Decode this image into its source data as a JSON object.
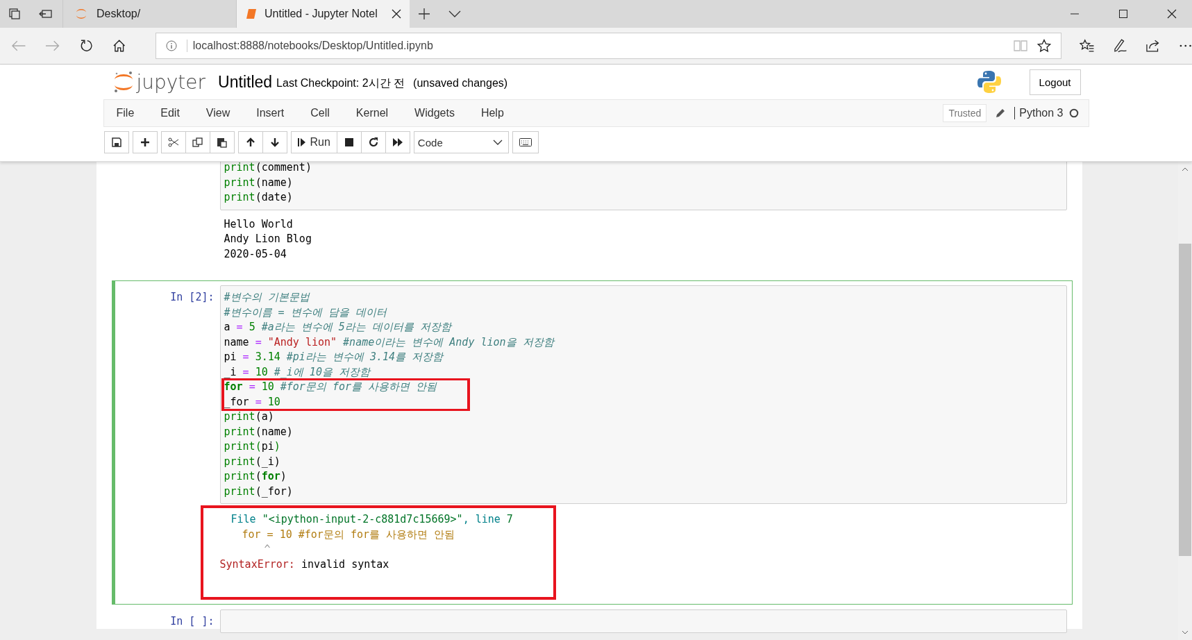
{
  "browser": {
    "tabs": [
      {
        "label": "Desktop/",
        "kind": "jupyter",
        "selected": false
      },
      {
        "label": "Untitled - Jupyter Notel",
        "kind": "notebook",
        "selected": true
      }
    ],
    "url": "localhost:8888/notebooks/Desktop/Untitled.ipynb"
  },
  "header": {
    "logo_text": "jupyter",
    "notebook_name": "Untitled",
    "checkpoint": "Last Checkpoint: 2시간 전",
    "status": "(unsaved changes)",
    "logout": "Logout"
  },
  "menu": [
    "File",
    "Edit",
    "View",
    "Insert",
    "Cell",
    "Kernel",
    "Widgets",
    "Help"
  ],
  "trusted": "Trusted",
  "kernel": "Python 3",
  "toolbar": {
    "run_label": "Run",
    "cell_type": "Code"
  },
  "cells": [
    {
      "selected": false,
      "input": [
        {
          "marked": false,
          "tokens": [
            {
              "kind": "builtin",
              "text": "print"
            },
            {
              "kind": "plain",
              "text": "(comment)"
            }
          ]
        },
        {
          "marked": false,
          "tokens": [
            {
              "kind": "builtin",
              "text": "print"
            },
            {
              "kind": "plain",
              "text": "(name)"
            }
          ]
        },
        {
          "marked": false,
          "tokens": [
            {
              "kind": "builtin",
              "text": "print"
            },
            {
              "kind": "plain",
              "text": "(date)"
            }
          ]
        }
      ],
      "output": {
        "kind": "stream",
        "marked": false,
        "lines": [
          [
            {
              "kind": "plain",
              "text": "Hello World"
            }
          ],
          [
            {
              "kind": "plain",
              "text": "Andy Lion Blog"
            }
          ],
          [
            {
              "kind": "plain",
              "text": "2020-05-04"
            }
          ]
        ]
      }
    },
    {
      "prompt": "In [2]:",
      "selected": true,
      "input": [
        {
          "marked": false,
          "tokens": [
            {
              "kind": "comment",
              "text": "#변수의 기본문법"
            }
          ]
        },
        {
          "marked": false,
          "tokens": [
            {
              "kind": "comment",
              "text": "#변수이름 = 변수에 담을 데이터"
            }
          ]
        },
        {
          "marked": false,
          "tokens": [
            {
              "kind": "plain",
              "text": "a "
            },
            {
              "kind": "op",
              "text": "= "
            },
            {
              "kind": "number",
              "text": "5 "
            },
            {
              "kind": "comment",
              "text": "#a라는 변수에 5라는 데이터를 저장함"
            }
          ]
        },
        {
          "marked": false,
          "tokens": [
            {
              "kind": "plain",
              "text": "name "
            },
            {
              "kind": "op",
              "text": "= "
            },
            {
              "kind": "string",
              "text": "\"Andy lion\" "
            },
            {
              "kind": "comment",
              "text": "#name이라는 변수에 Andy lion을 저장함"
            }
          ]
        },
        {
          "marked": false,
          "tokens": [
            {
              "kind": "plain",
              "text": "pi "
            },
            {
              "kind": "op",
              "text": "= "
            },
            {
              "kind": "number",
              "text": "3.14 "
            },
            {
              "kind": "comment",
              "text": "#pi라는 변수에 3.14를 저장함"
            }
          ]
        },
        {
          "marked": false,
          "tokens": [
            {
              "kind": "plain",
              "text": "_i "
            },
            {
              "kind": "op",
              "text": "= "
            },
            {
              "kind": "number",
              "text": "10 "
            },
            {
              "kind": "comment",
              "text": "#_i에 10을 저장함"
            }
          ]
        },
        {
          "marked": true,
          "tokens": [
            {
              "kind": "keyword",
              "text": "for "
            },
            {
              "kind": "op",
              "text": "= "
            },
            {
              "kind": "number",
              "text": "10 "
            },
            {
              "kind": "comment",
              "text": "#for문의 for를 사용하면 안됨"
            }
          ]
        },
        {
          "marked": true,
          "tokens": [
            {
              "kind": "plain",
              "text": "_for "
            },
            {
              "kind": "op",
              "text": "= "
            },
            {
              "kind": "number",
              "text": "10"
            }
          ]
        },
        {
          "marked": false,
          "tokens": [
            {
              "kind": "builtin",
              "text": "print"
            },
            {
              "kind": "plain",
              "text": "(a)"
            }
          ]
        },
        {
          "marked": false,
          "tokens": [
            {
              "kind": "builtin",
              "text": "print"
            },
            {
              "kind": "plain",
              "text": "(name)"
            }
          ]
        },
        {
          "marked": false,
          "tokens": [
            {
              "kind": "builtin",
              "text": "print"
            },
            {
              "kind": "match",
              "text": "("
            },
            {
              "kind": "plain",
              "text": "pi"
            },
            {
              "kind": "match",
              "text": ")"
            }
          ]
        },
        {
          "marked": false,
          "tokens": [
            {
              "kind": "builtin",
              "text": "print"
            },
            {
              "kind": "plain",
              "text": "(_i)"
            }
          ]
        },
        {
          "marked": false,
          "tokens": [
            {
              "kind": "builtin",
              "text": "print"
            },
            {
              "kind": "plain",
              "text": "("
            },
            {
              "kind": "keyword",
              "text": "for"
            },
            {
              "kind": "plain",
              "text": ")"
            }
          ]
        },
        {
          "marked": false,
          "tokens": [
            {
              "kind": "builtin",
              "text": "print"
            },
            {
              "kind": "plain",
              "text": "(_for)"
            }
          ]
        }
      ],
      "output": {
        "kind": "error",
        "marked": true,
        "lines": [
          [
            {
              "kind": "tb-file",
              "text": "File "
            },
            {
              "kind": "tb-path",
              "text": "\"<ipython-input-2-c881d7c15669>\""
            },
            {
              "kind": "tb-file",
              "text": ", line "
            },
            {
              "kind": "tb-num",
              "text": "7"
            }
          ],
          [
            {
              "kind": "tb-code",
              "text": "for = 10 #for문의 for를 사용하면 안됨"
            }
          ],
          [
            {
              "kind": "tb-caret",
              "text": "^"
            }
          ],
          [
            {
              "kind": "err-name",
              "text": "SyntaxError:"
            },
            {
              "kind": "plain",
              "text": " invalid syntax"
            }
          ]
        ]
      }
    },
    {
      "prompt": "In [ ]:",
      "selected": false
    }
  ]
}
